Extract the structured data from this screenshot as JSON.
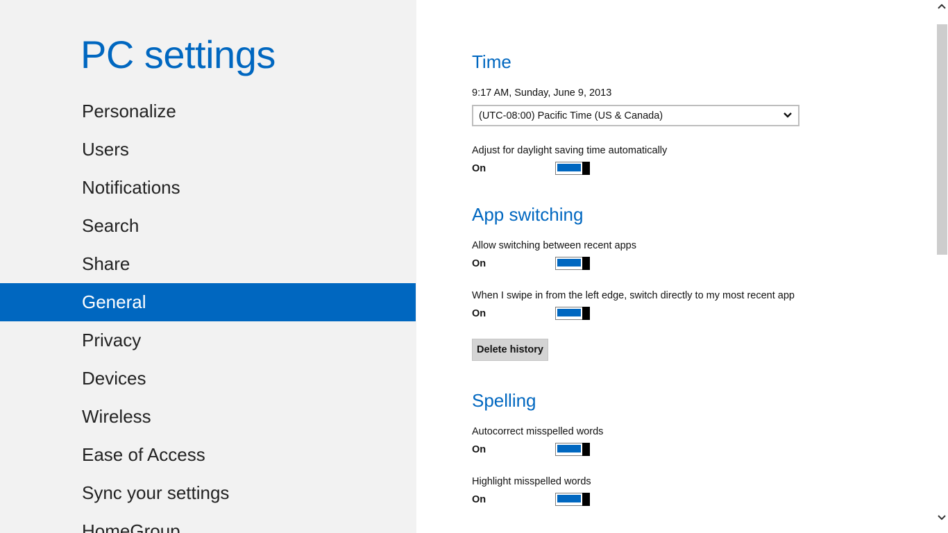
{
  "app": {
    "title": "PC settings"
  },
  "sidebar": {
    "items": [
      {
        "label": "Personalize"
      },
      {
        "label": "Users"
      },
      {
        "label": "Notifications"
      },
      {
        "label": "Search"
      },
      {
        "label": "Share"
      },
      {
        "label": "General",
        "selected": true
      },
      {
        "label": "Privacy"
      },
      {
        "label": "Devices"
      },
      {
        "label": "Wireless"
      },
      {
        "label": "Ease of Access"
      },
      {
        "label": "Sync your settings"
      },
      {
        "label": "HomeGroup"
      }
    ]
  },
  "time": {
    "heading": "Time",
    "current": "9:17 AM, Sunday, June 9, 2013",
    "timezone": "(UTC-08:00) Pacific Time (US & Canada)",
    "dst_label": "Adjust for daylight saving time automatically",
    "dst_state": "On"
  },
  "app_switching": {
    "heading": "App switching",
    "allow_label": "Allow switching between recent apps",
    "allow_state": "On",
    "swipe_label": "When I swipe in from the left edge, switch directly to my most recent app",
    "swipe_state": "On",
    "delete_history_label": "Delete history"
  },
  "spelling": {
    "heading": "Spelling",
    "autocorrect_label": "Autocorrect misspelled words",
    "autocorrect_state": "On",
    "highlight_label": "Highlight misspelled words",
    "highlight_state": "On"
  },
  "colors": {
    "accent": "#0067c0",
    "sidebar_bg": "#f2f2f2",
    "content_bg": "#ffffff",
    "button_bg": "#d4d4d4"
  },
  "icons": {
    "dropdown": "chevron-down-icon",
    "scroll_up": "scroll-up-arrow-icon",
    "scroll_down": "scroll-down-arrow-icon"
  }
}
